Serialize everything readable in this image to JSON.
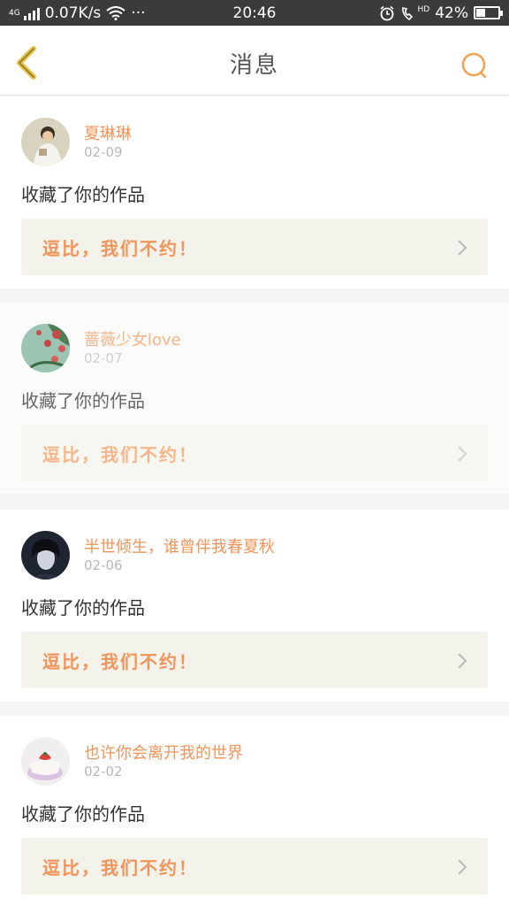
{
  "status_bar": {
    "net_label": "4G",
    "speed": "0.07K/s",
    "dots": "···",
    "time": "20:46",
    "hd_label": "HD",
    "battery": "42%",
    "battery_level": 0.42
  },
  "nav": {
    "title": "消息",
    "accent_color": "#f0a14f"
  },
  "messages": [
    {
      "name": "夏琳琳",
      "date": "02-09",
      "action": "收藏了你的作品",
      "quote": "逗比，我们不约！",
      "avatar": "boy-photo-icon"
    },
    {
      "name": "蔷薇少女love",
      "date": "02-07",
      "action": "收藏了你的作品",
      "quote": "逗比，我们不约！",
      "avatar": "rose-photo-icon"
    },
    {
      "name": "半世倾生，谁曾伴我春夏秋",
      "date": "02-06",
      "action": "收藏了你的作品",
      "quote": "逗比，我们不约！",
      "avatar": "dark-portrait-icon"
    },
    {
      "name": "也许你会离开我的世界",
      "date": "02-02",
      "action": "收藏了你的作品",
      "quote": "逗比，我们不约！",
      "avatar": "cake-photo-icon"
    }
  ]
}
